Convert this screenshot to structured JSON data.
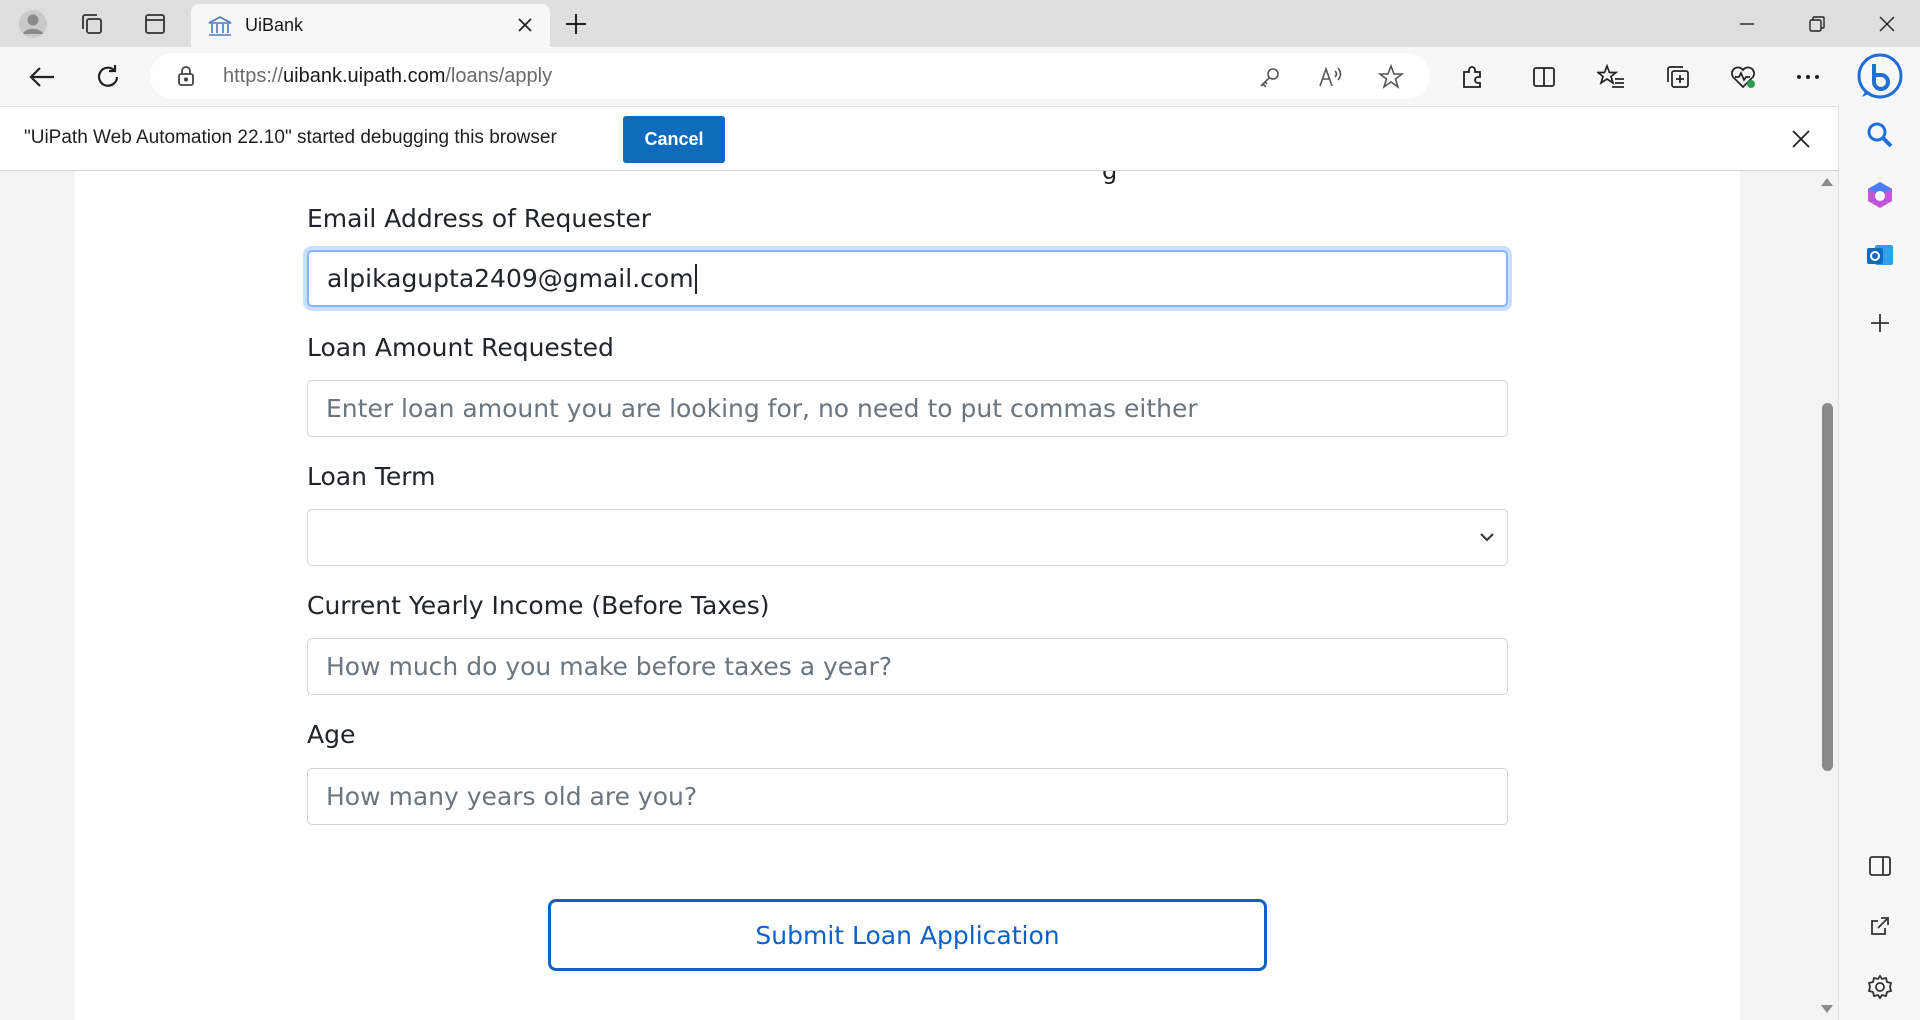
{
  "browser": {
    "tab": {
      "title": "UiBank"
    },
    "address": {
      "prefix": "https://",
      "host": "uibank.uipath.com",
      "path": "/loans/apply"
    }
  },
  "infobar": {
    "message": "\"UiPath Web Automation 22.10\" started debugging this browser",
    "cancel_label": "Cancel"
  },
  "form": {
    "partial_heading_glyph": "g",
    "email": {
      "label": "Email Address of Requester",
      "value": "alpikagupta2409@gmail.com"
    },
    "amount": {
      "label": "Loan Amount Requested",
      "placeholder": "Enter loan amount you are looking for, no need to put commas either"
    },
    "term": {
      "label": "Loan Term",
      "value": ""
    },
    "income": {
      "label": "Current Yearly Income (Before Taxes)",
      "placeholder": "How much do you make before taxes a year?"
    },
    "age": {
      "label": "Age",
      "placeholder": "How many years old are you?"
    },
    "submit_label": "Submit Loan Application"
  },
  "colors": {
    "accent": "#0d60c8",
    "infobar_button": "#0f6cbd",
    "focus_ring": "#86b7fe"
  },
  "icons": [
    "profile-icon",
    "workspaces-icon",
    "vertical-tabs-icon",
    "bank-favicon",
    "close-icon",
    "plus-icon",
    "minimize-icon",
    "restore-icon",
    "back-icon",
    "refresh-icon",
    "lock-icon",
    "key-icon",
    "read-aloud-icon",
    "star-icon",
    "extensions-icon",
    "split-screen-icon",
    "favorites-icon",
    "collections-icon",
    "browser-essentials-icon",
    "more-icon",
    "copilot-icon",
    "search-icon",
    "office-icon",
    "outlook-icon",
    "add-icon",
    "sidebar-toggle-icon",
    "external-link-icon",
    "settings-icon",
    "chevron-down-icon"
  ]
}
